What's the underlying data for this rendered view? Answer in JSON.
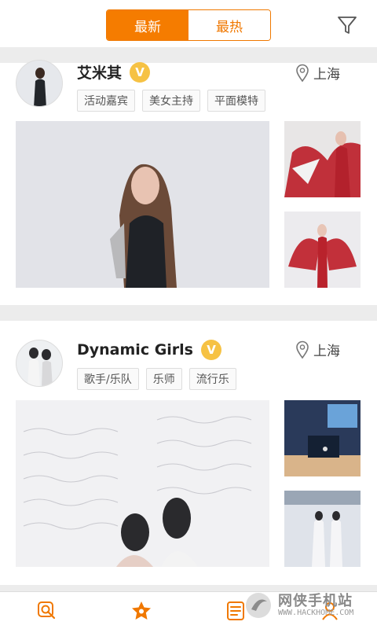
{
  "header": {
    "tabs": [
      {
        "label": "最新",
        "active": true
      },
      {
        "label": "最热",
        "active": false
      }
    ],
    "filter_icon": "filter-icon"
  },
  "cards": [
    {
      "name": "艾米其",
      "verified_badge": "V",
      "location": "上海",
      "tags": [
        "活动嘉宾",
        "美女主持",
        "平面模特"
      ]
    },
    {
      "name": "Dynamic Girls",
      "verified_badge": "V",
      "location": "上海",
      "tags": [
        "歌手/乐队",
        "乐师",
        "流行乐"
      ]
    }
  ],
  "bottom_nav": {
    "items": [
      {
        "icon": "search-icon"
      },
      {
        "icon": "star-badge-icon"
      },
      {
        "icon": "list-icon"
      },
      {
        "icon": "profile-icon"
      }
    ]
  },
  "watermark": {
    "text_cn": "网侠手机站",
    "url": "WWW.HACKHOME.COM"
  },
  "colors": {
    "accent": "#f57c00",
    "badge": "#f6c244",
    "band": "#ececec"
  }
}
